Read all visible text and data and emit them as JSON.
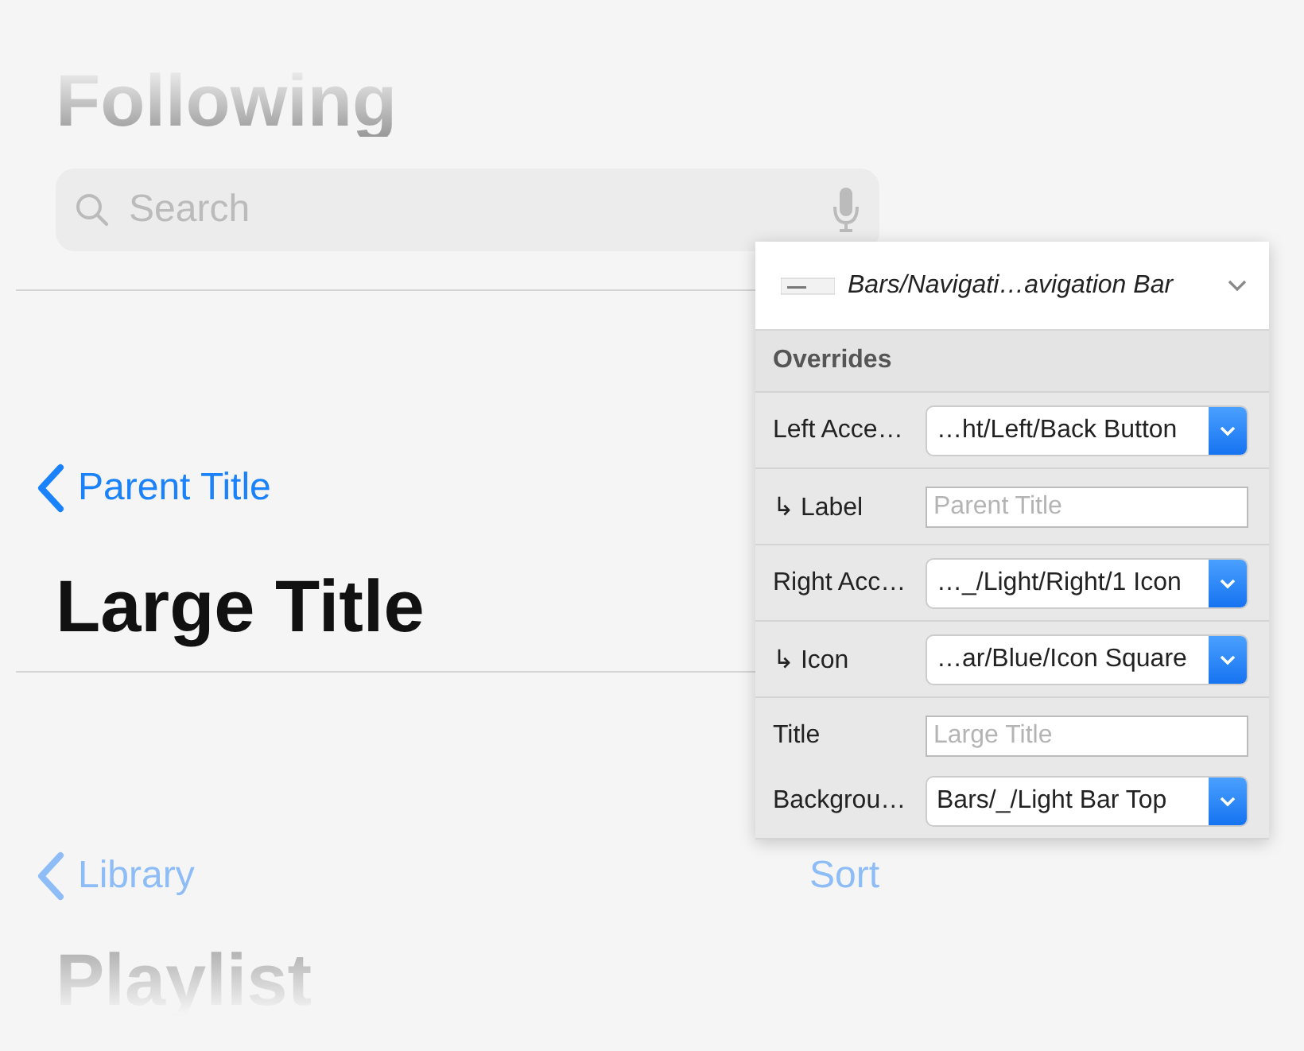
{
  "canvas": {
    "top_bar": {
      "title": "Following",
      "search": {
        "placeholder": "Search"
      }
    },
    "nav_bar": {
      "back": "Parent Title",
      "title": "Large Title"
    },
    "bottom_bar": {
      "back": "Library",
      "action": "Sort",
      "title": "Playlist"
    }
  },
  "inspector": {
    "symbol": "Bars/Navigati…avigation Bar",
    "section": "Overrides",
    "groups": [
      [
        {
          "label": "Left Acce…",
          "kind": "dropdown",
          "value": "…ht/Left/Back Button"
        }
      ],
      [
        {
          "label": "↳ Label",
          "kind": "text",
          "placeholder": "Parent Title"
        }
      ],
      [
        {
          "label": "Right Acc…",
          "kind": "dropdown",
          "value": "…_/Light/Right/1 Icon"
        }
      ],
      [
        {
          "label": "↳ Icon",
          "kind": "dropdown",
          "value": "…ar/Blue/Icon Square"
        }
      ],
      [
        {
          "label": "Title",
          "kind": "text",
          "placeholder": "Large Title"
        },
        {
          "label": "Backgrou…",
          "kind": "dropdown",
          "value": "Bars/_/Light Bar Top"
        }
      ]
    ]
  }
}
